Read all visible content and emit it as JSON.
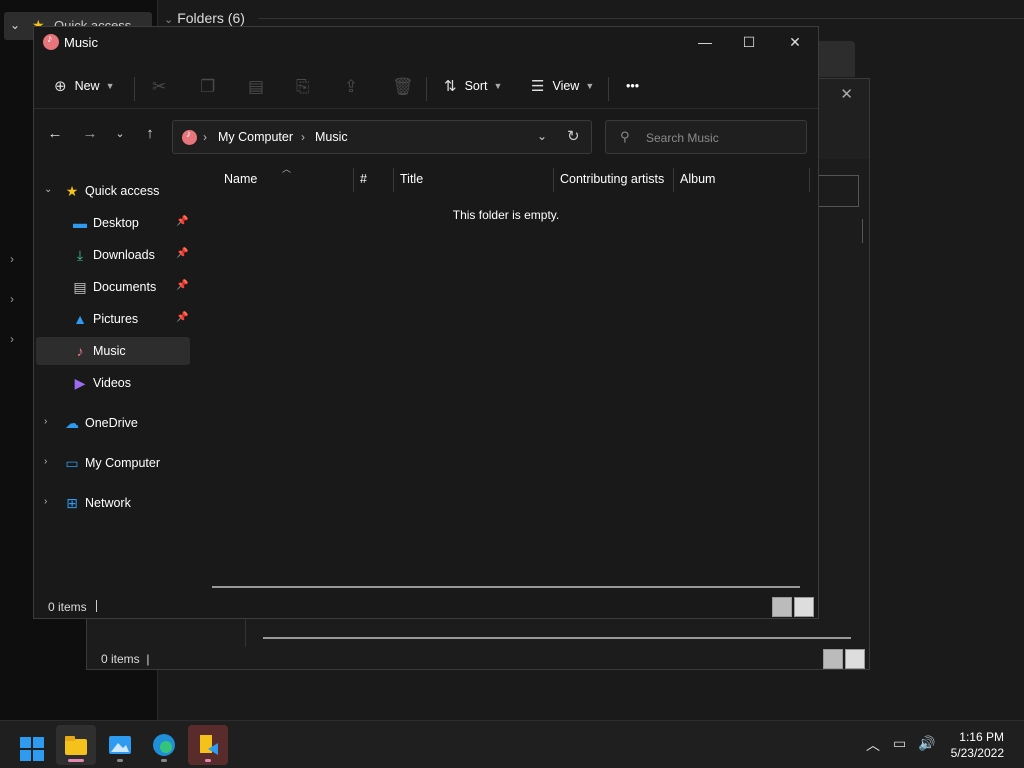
{
  "background": {
    "quick_access_label": "Quick access",
    "folders_label": "Folders (6)"
  },
  "behind_dialog": {
    "status_items": "0 items"
  },
  "window": {
    "title": "Music",
    "controls": {
      "minimize": "—",
      "maximize": "☐",
      "close": "✕"
    }
  },
  "toolbar": {
    "new_label": "New",
    "sort_label": "Sort",
    "view_label": "View",
    "more_label": "•••"
  },
  "address": {
    "parts": [
      "My Computer",
      "Music"
    ]
  },
  "search": {
    "placeholder": "Search Music"
  },
  "sidebar": {
    "quick_access": "Quick access",
    "items": [
      {
        "label": "Desktop",
        "icon": "desktop-icon",
        "pinned": true
      },
      {
        "label": "Downloads",
        "icon": "downloads-icon",
        "pinned": true
      },
      {
        "label": "Documents",
        "icon": "documents-icon",
        "pinned": true
      },
      {
        "label": "Pictures",
        "icon": "pictures-icon",
        "pinned": true
      },
      {
        "label": "Music",
        "icon": "music-icon",
        "pinned": false,
        "active": true
      },
      {
        "label": "Videos",
        "icon": "videos-icon",
        "pinned": false
      }
    ],
    "roots": [
      {
        "label": "OneDrive",
        "icon": "onedrive-icon"
      },
      {
        "label": "My Computer",
        "icon": "computer-icon"
      },
      {
        "label": "Network",
        "icon": "network-icon"
      }
    ]
  },
  "columns": [
    "Name",
    "#",
    "Title",
    "Contributing artists",
    "Album"
  ],
  "empty_message": "This folder is empty.",
  "status": {
    "items": "0 items"
  },
  "taskbar": {
    "time": "1:16 PM",
    "date": "5/23/2022"
  },
  "colors": {
    "music_accent": "#e8747c",
    "windows_blue": "#2f9bf0",
    "star": "#f4c21b"
  }
}
